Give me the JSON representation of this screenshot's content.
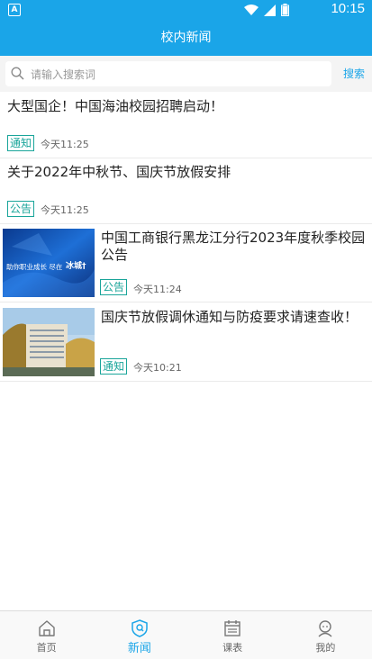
{
  "status": {
    "time": "10:15",
    "app_letter": "A"
  },
  "header": {
    "title": "校内新闻"
  },
  "search": {
    "placeholder": "请输入搜索词",
    "button": "搜索"
  },
  "news": [
    {
      "title": "大型国企！中国海油校园招聘启动！",
      "tag": "通知",
      "time": "今天11:25"
    },
    {
      "title": "关于2022年中秋节、国庆节放假安排",
      "tag": "公告",
      "time": "今天11:25"
    },
    {
      "title": "中国工商银行黑龙江分行2023年度秋季校园公告",
      "tag": "公告",
      "time": "今天11:24",
      "image_text": "助你职业成长 尽在",
      "image_logo": "冰城†"
    },
    {
      "title": "国庆节放假调休通知与防疫要求请速查收！",
      "tag": "通知",
      "time": "今天10:21"
    }
  ],
  "nav": [
    {
      "label": "首页",
      "icon": "home-icon"
    },
    {
      "label": "新闻",
      "icon": "news-icon"
    },
    {
      "label": "课表",
      "icon": "schedule-icon"
    },
    {
      "label": "我的",
      "icon": "profile-icon"
    }
  ],
  "colors": {
    "accent": "#1aa5e8",
    "tag": "#1aa59a"
  }
}
